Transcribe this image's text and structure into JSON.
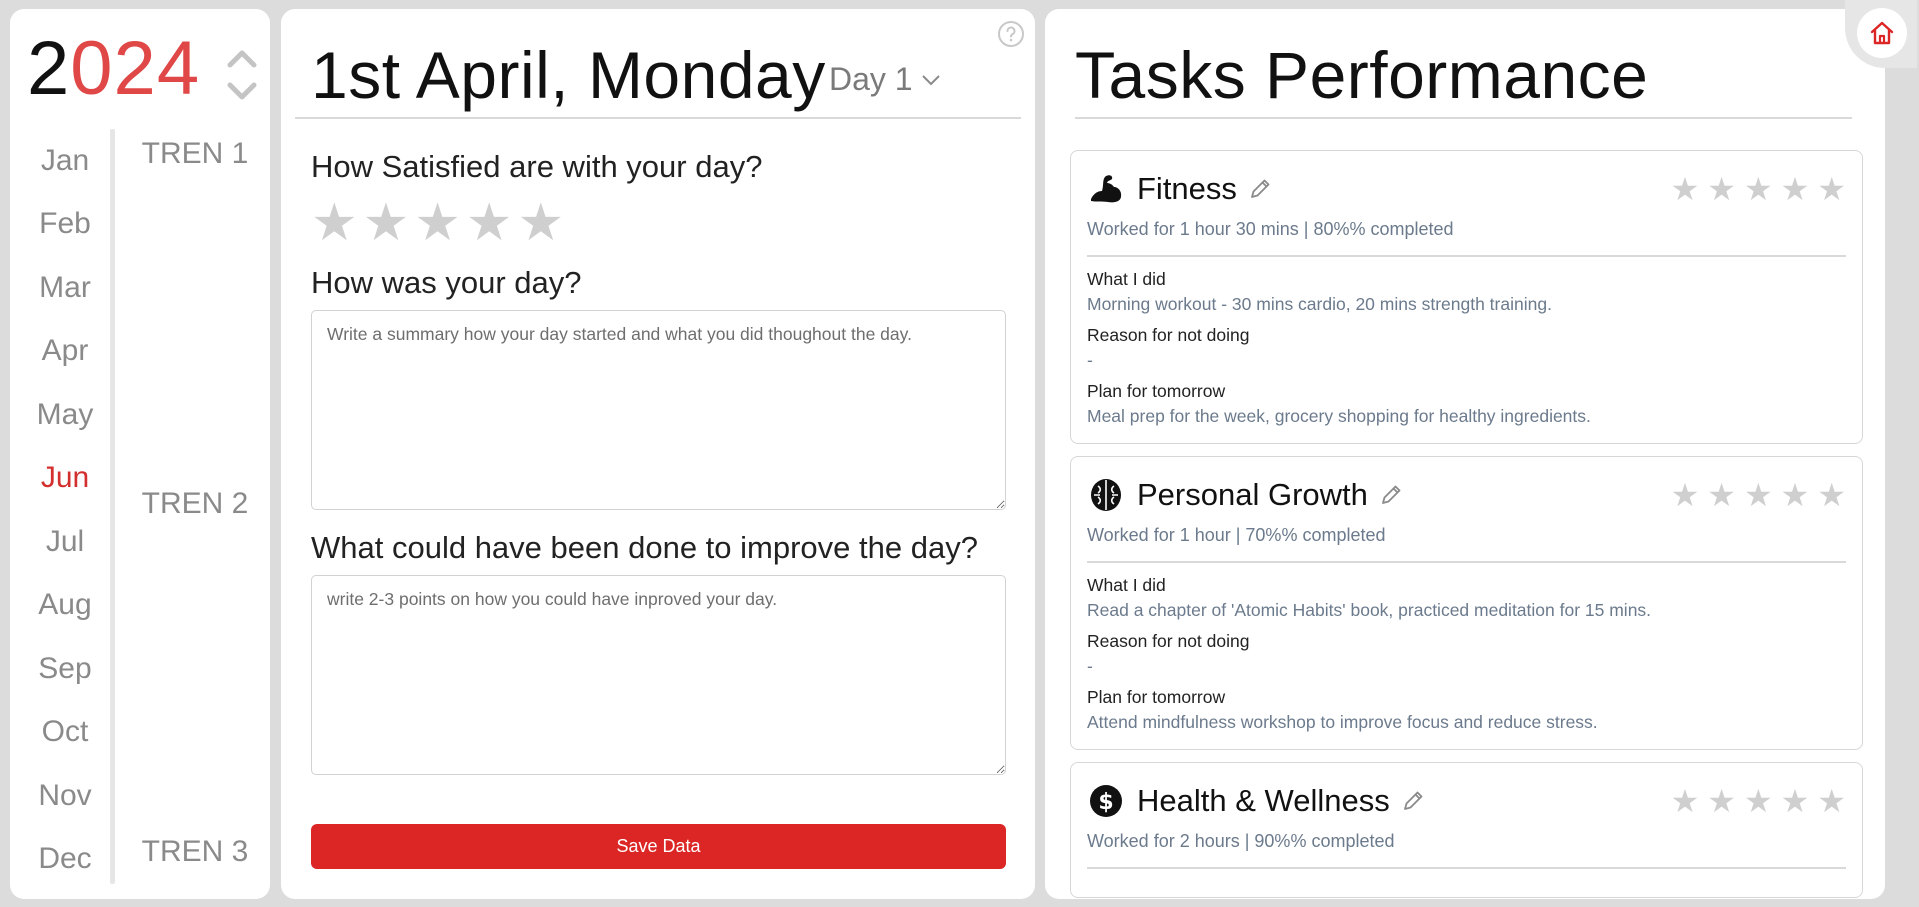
{
  "year": {
    "prefix": "2",
    "suffix": "024"
  },
  "months": [
    {
      "label": "Jan",
      "active": false
    },
    {
      "label": "Feb",
      "active": false
    },
    {
      "label": "Mar",
      "active": false
    },
    {
      "label": "Apr",
      "active": false
    },
    {
      "label": "May",
      "active": false
    },
    {
      "label": "Jun",
      "active": true
    },
    {
      "label": "Jul",
      "active": false
    },
    {
      "label": "Aug",
      "active": false
    },
    {
      "label": "Sep",
      "active": false
    },
    {
      "label": "Oct",
      "active": false
    },
    {
      "label": "Nov",
      "active": false
    },
    {
      "label": "Dec",
      "active": false
    }
  ],
  "terms": [
    "TREN 1",
    "TREN 2",
    "TREN 3"
  ],
  "day": {
    "title": "1st April, Monday",
    "selector": "Day 1",
    "q_satisfied": "How Satisfied are with your day?",
    "rating": 0,
    "q_how_was": "How was your day?",
    "summary_placeholder": "Write a summary how your day started and what you did thoughout the day.",
    "q_improve": "What could have been done to improve the day?",
    "improve_placeholder": "write 2-3 points on how you could have inproved your day.",
    "save_label": "Save Data"
  },
  "performance": {
    "title": "Tasks Performance",
    "labels": {
      "what_i_did": "What I did",
      "reason": "Reason for not doing",
      "plan": "Plan for tomorrow"
    },
    "tasks": [
      {
        "name": "Fitness",
        "icon": "muscle-icon",
        "summary": "Worked for 1 hour 30 mins | 80%% completed",
        "what_i_did": "Morning workout - 30 mins cardio, 20 mins strength training.",
        "reason": "-",
        "plan": "Meal prep for the week, grocery shopping for healthy ingredients.",
        "rating": 0
      },
      {
        "name": "Personal Growth",
        "icon": "brain-icon",
        "summary": "Worked for 1 hour | 70%% completed",
        "what_i_did": "Read a chapter of 'Atomic Habits' book, practiced meditation for 15 mins.",
        "reason": "-",
        "plan": "Attend mindfulness workshop to improve focus and reduce stress.",
        "rating": 0
      },
      {
        "name": "Health & Wellness",
        "icon": "dollar-icon",
        "summary": "Worked for 2 hours | 90%% completed",
        "rating": 0
      }
    ]
  },
  "colors": {
    "accent": "#dc2626",
    "year_accent": "#e04747",
    "muted": "#8a8a8a",
    "star_empty": "#cfcfcf"
  }
}
